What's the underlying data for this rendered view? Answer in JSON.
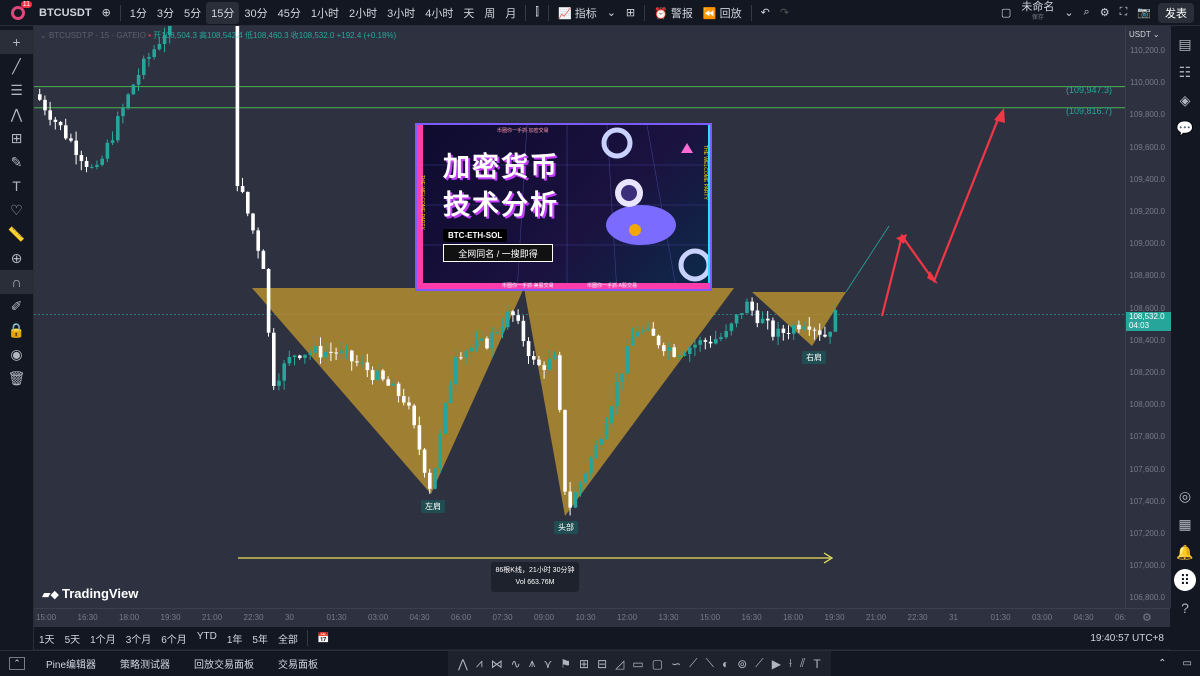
{
  "topbar": {
    "symbol": "BTCUSDT",
    "badge": "11",
    "intervals": [
      "1分",
      "3分",
      "5分",
      "15分",
      "30分",
      "45分",
      "1小时",
      "2小时",
      "3小时",
      "4小时",
      "天",
      "周",
      "月"
    ],
    "active_interval": "15分",
    "indicators_label": "指标",
    "alert_label": "警报",
    "replay_label": "回放",
    "layout_name": "未命名",
    "layout_sub": "保存",
    "publish_label": "发表"
  },
  "legend": {
    "symbol": "BTCUSDT.P · 15 · GATEIO",
    "open": "108,504.3",
    "high": "108,542.4",
    "low": "108,460.3",
    "close": "108,532.0",
    "change": "+192.4 (+0.18%)"
  },
  "price_axis": {
    "currency": "USDT",
    "ticks": [
      "110,200.0",
      "110,000.0",
      "109,800.0",
      "109,600.0",
      "109,400.0",
      "109,200.0",
      "109,000.0",
      "108,800.0",
      "108,600.0",
      "108,400.0",
      "108,200.0",
      "108,000.0",
      "107,800.0",
      "107,600.0",
      "107,400.0",
      "107,200.0",
      "107,000.0",
      "106,800.0"
    ],
    "current_price": "108,532.0",
    "countdown": "04:03"
  },
  "levels": [
    {
      "label": "(109,947.3)",
      "price": 109947.3
    },
    {
      "label": "(109,816.7)",
      "price": 109816.7
    }
  ],
  "time_axis": [
    "15:00",
    "16:30",
    "18:00",
    "19:30",
    "21:00",
    "22:30",
    "30",
    "01:30",
    "03:00",
    "04:30",
    "06:00",
    "07:30",
    "09:00",
    "10:30",
    "12:00",
    "13:30",
    "15:00",
    "16:30",
    "18:00",
    "19:30",
    "21:00",
    "22:30",
    "31",
    "01:30",
    "03:00",
    "04:30",
    "06:"
  ],
  "promo": {
    "top_tag": "币圈你一手抓·加密交易",
    "title_line1": "加密货币",
    "title_line2": "技术分析",
    "pill": "BTC-ETH-SOL",
    "box_text": "全网同名 / 一搜即得",
    "bottom_tag1": "币圈你一手抓·美股交易",
    "bottom_tag2": "币圈你一手抓·A股交易",
    "side_text": "THE WELCOME PARTY"
  },
  "pattern": {
    "left_shoulder": "左肩",
    "head": "头部",
    "right_shoulder": "右肩"
  },
  "measure": {
    "line1": "86根K线，21小时 30分钟",
    "line2": "Vol 663.76M"
  },
  "watermark": "TradingView",
  "ranges": [
    "1天",
    "5天",
    "1个月",
    "3个月",
    "6个月",
    "YTD",
    "1年",
    "5年",
    "全部"
  ],
  "clock": "19:40:57 UTC+8",
  "bottom_tabs": [
    "Pine编辑器",
    "策略测试器",
    "回放交易面板",
    "交易面板"
  ],
  "colors": {
    "up": "#26a69a",
    "down": "#ffffff",
    "pattern_fill": "#b8902f",
    "arrow": "#f23645",
    "level_line": "#4caf50"
  }
}
